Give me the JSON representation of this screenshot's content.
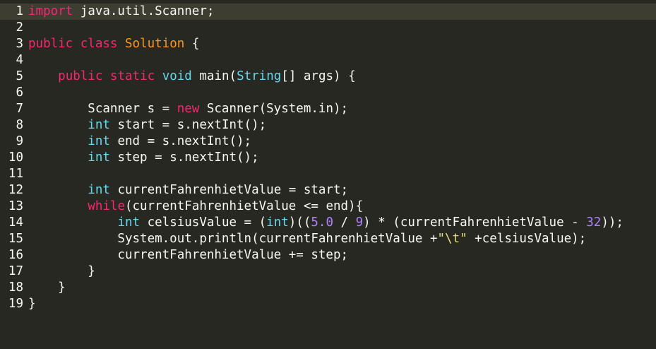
{
  "editor": {
    "active_line": 1,
    "lines": [
      {
        "n": "1",
        "tokens": [
          {
            "t": "import",
            "c": "kw"
          },
          {
            "t": " java.util.Scanner;",
            "c": "pl"
          }
        ]
      },
      {
        "n": "2",
        "tokens": []
      },
      {
        "n": "3",
        "tokens": [
          {
            "t": "public",
            "c": "kw"
          },
          {
            "t": " ",
            "c": "pl"
          },
          {
            "t": "class",
            "c": "kw"
          },
          {
            "t": " ",
            "c": "pl"
          },
          {
            "t": "Solution",
            "c": "cls"
          },
          {
            "t": " {",
            "c": "pl"
          }
        ]
      },
      {
        "n": "4",
        "tokens": []
      },
      {
        "n": "5",
        "tokens": [
          {
            "t": "    ",
            "c": "pl"
          },
          {
            "t": "public",
            "c": "kw"
          },
          {
            "t": " ",
            "c": "pl"
          },
          {
            "t": "static",
            "c": "kw"
          },
          {
            "t": " ",
            "c": "pl"
          },
          {
            "t": "void",
            "c": "ty"
          },
          {
            "t": " main(",
            "c": "pl"
          },
          {
            "t": "String",
            "c": "ty"
          },
          {
            "t": "[] args) {",
            "c": "pl"
          }
        ]
      },
      {
        "n": "6",
        "tokens": []
      },
      {
        "n": "7",
        "tokens": [
          {
            "t": "        Scanner s = ",
            "c": "pl"
          },
          {
            "t": "new",
            "c": "kw"
          },
          {
            "t": " Scanner(System.in);",
            "c": "pl"
          }
        ]
      },
      {
        "n": "8",
        "tokens": [
          {
            "t": "        ",
            "c": "pl"
          },
          {
            "t": "int",
            "c": "ty"
          },
          {
            "t": " start = s.nextInt();",
            "c": "pl"
          }
        ]
      },
      {
        "n": "9",
        "tokens": [
          {
            "t": "        ",
            "c": "pl"
          },
          {
            "t": "int",
            "c": "ty"
          },
          {
            "t": " end = s.nextInt();",
            "c": "pl"
          }
        ]
      },
      {
        "n": "10",
        "tokens": [
          {
            "t": "        ",
            "c": "pl"
          },
          {
            "t": "int",
            "c": "ty"
          },
          {
            "t": " step = s.nextInt();",
            "c": "pl"
          }
        ]
      },
      {
        "n": "11",
        "tokens": []
      },
      {
        "n": "12",
        "tokens": [
          {
            "t": "        ",
            "c": "pl"
          },
          {
            "t": "int",
            "c": "ty"
          },
          {
            "t": " currentFahrenhietValue = start;",
            "c": "pl"
          }
        ]
      },
      {
        "n": "13",
        "tokens": [
          {
            "t": "        ",
            "c": "pl"
          },
          {
            "t": "while",
            "c": "kw"
          },
          {
            "t": "(currentFahrenhietValue <= end){",
            "c": "pl"
          }
        ]
      },
      {
        "n": "14",
        "tokens": [
          {
            "t": "            ",
            "c": "pl"
          },
          {
            "t": "int",
            "c": "ty"
          },
          {
            "t": " celsiusValue = (",
            "c": "pl"
          },
          {
            "t": "int",
            "c": "ty"
          },
          {
            "t": ")((",
            "c": "pl"
          },
          {
            "t": "5.0",
            "c": "num"
          },
          {
            "t": " / ",
            "c": "pl"
          },
          {
            "t": "9",
            "c": "num"
          },
          {
            "t": ") * (currentFahrenhietValue - ",
            "c": "pl"
          },
          {
            "t": "32",
            "c": "num"
          },
          {
            "t": "));",
            "c": "pl"
          }
        ]
      },
      {
        "n": "15",
        "tokens": [
          {
            "t": "            System.out.println(currentFahrenhietValue +",
            "c": "pl"
          },
          {
            "t": "\"\\t\"",
            "c": "str"
          },
          {
            "t": " +celsiusValue);",
            "c": "pl"
          }
        ]
      },
      {
        "n": "16",
        "tokens": [
          {
            "t": "            currentFahrenhietValue += step;",
            "c": "pl"
          }
        ]
      },
      {
        "n": "17",
        "tokens": [
          {
            "t": "        }",
            "c": "pl"
          }
        ]
      },
      {
        "n": "18",
        "tokens": [
          {
            "t": "    }",
            "c": "pl"
          }
        ]
      },
      {
        "n": "19",
        "tokens": [
          {
            "t": "}",
            "c": "pl"
          }
        ]
      }
    ]
  },
  "colors": {
    "background": "#272822",
    "active_line": "#3e3d32",
    "keyword": "#f92672",
    "type": "#66d9ef",
    "class_name": "#fd971f",
    "number": "#ae81ff",
    "string": "#e6db74",
    "plain": "#f8f8f2"
  }
}
